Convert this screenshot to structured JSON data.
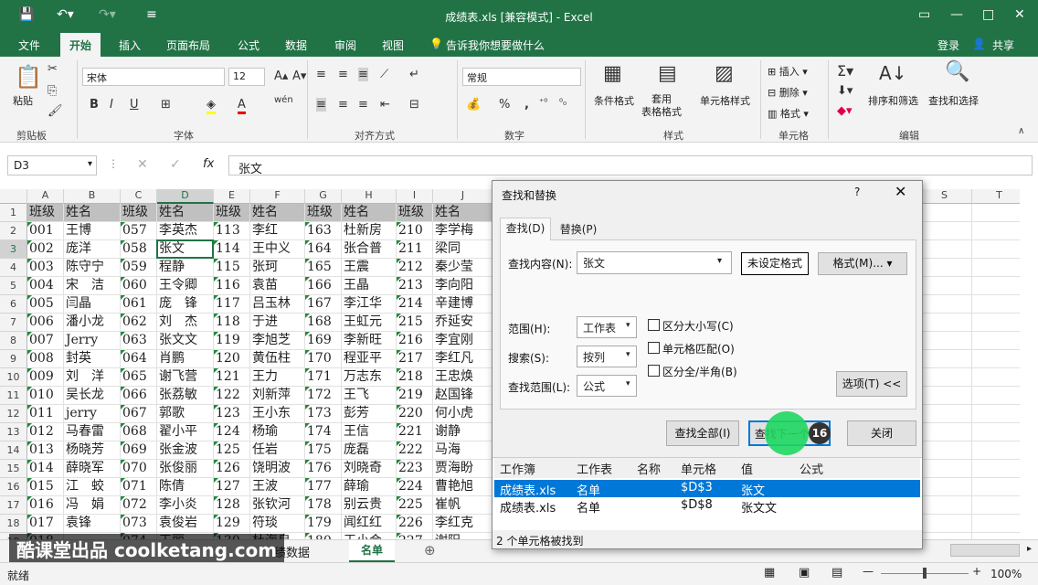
{
  "title": "成绩表.xls  [兼容模式] - Excel",
  "tabs": [
    "文件",
    "开始",
    "插入",
    "页面布局",
    "公式",
    "数据",
    "审阅",
    "视图"
  ],
  "tell_me": "告诉我你想要做什么",
  "login": "登录",
  "share": "共享",
  "ribbon": {
    "paste": "粘贴",
    "clipboard": "剪贴板",
    "font_name": "宋体",
    "font_size": "12",
    "font": "字体",
    "alignment": "对齐方式",
    "number_format": "常规",
    "number": "数字",
    "cond_format": "条件格式",
    "table_format": "套用\n表格格式",
    "cell_style": "单元格样式",
    "styles": "样式",
    "insert": "插入",
    "delete": "删除",
    "format": "格式",
    "cells": "单元格",
    "sort_filter": "排序和筛选",
    "find_select": "查找和选择",
    "editing": "编辑",
    "bold": "B",
    "italic": "I",
    "underline": "U",
    "font_a": "A",
    "wen": "wén",
    "percent": "%",
    "comma": ","
  },
  "namebox": "D3",
  "formula": "张文",
  "columns": [
    "A",
    "B",
    "C",
    "D",
    "E",
    "F",
    "G",
    "H",
    "I",
    "J",
    "",
    "",
    "",
    "",
    "S",
    "T"
  ],
  "rows": [
    [
      "班级",
      "姓名",
      "班级",
      "姓名",
      "班级",
      "姓名",
      "班级",
      "姓名",
      "班级",
      "姓名"
    ],
    [
      "001",
      "王博",
      "057",
      "李英杰",
      "113",
      "李红",
      "163",
      "杜新房",
      "210",
      "李学梅"
    ],
    [
      "002",
      "庞洋",
      "058",
      "张文",
      "114",
      "王中义",
      "164",
      "张合普",
      "211",
      "梁同"
    ],
    [
      "003",
      "陈守宁",
      "059",
      "程静",
      "115",
      "张珂",
      "165",
      "王震",
      "212",
      "秦少莹"
    ],
    [
      "004",
      "宋　洁",
      "060",
      "王令卿",
      "116",
      "袁苗",
      "166",
      "王晶",
      "213",
      "李向阳"
    ],
    [
      "005",
      "闫晶",
      "061",
      "庞　锋",
      "117",
      "吕玉林",
      "167",
      "李江华",
      "214",
      "辛建博"
    ],
    [
      "006",
      "潘小龙",
      "062",
      "刘　杰",
      "118",
      "于进",
      "168",
      "王虹元",
      "215",
      "乔延安"
    ],
    [
      "007",
      "Jerry",
      "063",
      "张文文",
      "119",
      "李旭芝",
      "169",
      "李新旺",
      "216",
      "李宜刚"
    ],
    [
      "008",
      "封英",
      "064",
      "肖鹏",
      "120",
      "黄伍柱",
      "170",
      "程亚平",
      "217",
      "李红凡"
    ],
    [
      "009",
      "刘　洋",
      "065",
      "谢飞营",
      "121",
      "王力",
      "171",
      "万志东",
      "218",
      "王忠焕"
    ],
    [
      "010",
      "吴长龙",
      "066",
      "张荔敏",
      "122",
      "刘新萍",
      "172",
      "王飞",
      "219",
      "赵国锋"
    ],
    [
      "011",
      "jerry",
      "067",
      "郭歌",
      "123",
      "王小东",
      "173",
      "彭芳",
      "220",
      "何小虎"
    ],
    [
      "012",
      "马春雷",
      "068",
      "翟小平",
      "124",
      "杨瑜",
      "174",
      "王信",
      "221",
      "谢静"
    ],
    [
      "013",
      "杨晓芳",
      "069",
      "张金波",
      "125",
      "任岩",
      "175",
      "庞磊",
      "222",
      "马海"
    ],
    [
      "014",
      "薛晓军",
      "070",
      "张俊丽",
      "126",
      "饶明波",
      "176",
      "刘晓奇",
      "223",
      "贾海盼"
    ],
    [
      "015",
      "江　蛟",
      "071",
      "陈倩",
      "127",
      "王波",
      "177",
      "薛瑜",
      "224",
      "曹艳旭"
    ],
    [
      "016",
      "冯　娟",
      "072",
      "李小炎",
      "128",
      "张钦河",
      "178",
      "别云贵",
      "225",
      "崔帆"
    ],
    [
      "017",
      "袁锋",
      "073",
      "袁俊岩",
      "129",
      "符琰",
      "179",
      "闻红红",
      "226",
      "李红克"
    ],
    [
      "018",
      "",
      "074",
      "王丽",
      "130",
      "杜海泉",
      "180",
      "王小会",
      "227",
      "谢阳"
    ]
  ],
  "sheets": [
    "绩数据",
    "名单"
  ],
  "watermark": "酷课堂出品 coolketang.com",
  "status": "就绪",
  "zoom": "100%",
  "dialog": {
    "title": "查找和替换",
    "help": "?",
    "tab_find": "查找(D)",
    "tab_replace": "替换(P)",
    "find_label": "查找内容(N):",
    "find_value": "张文",
    "no_format": "未设定格式",
    "format_btn": "格式(M)...",
    "scope_label": "范围(H):",
    "scope_value": "工作表",
    "search_label": "搜索(S):",
    "search_value": "按列",
    "lookin_label": "查找范围(L):",
    "lookin_value": "公式",
    "match_case": "区分大小写(C)",
    "match_cell": "单元格匹配(O)",
    "match_width": "区分全/半角(B)",
    "options": "选项(T) <<",
    "find_all": "查找全部(I)",
    "find_next": "查找下一个(F)",
    "close": "关闭",
    "click_badge": "16",
    "headers": [
      "工作簿",
      "工作表",
      "名称",
      "单元格",
      "值",
      "公式"
    ],
    "results": [
      [
        "成绩表.xls",
        "名单",
        "",
        "$D$3",
        "张文",
        ""
      ],
      [
        "成绩表.xls",
        "名单",
        "",
        "$D$8",
        "张文文",
        ""
      ]
    ],
    "summary": "2 个单元格被找到"
  },
  "colors": {
    "excel_green": "#217346",
    "selection_blue": "#0078d7",
    "highlight_green": "#1ed760"
  }
}
